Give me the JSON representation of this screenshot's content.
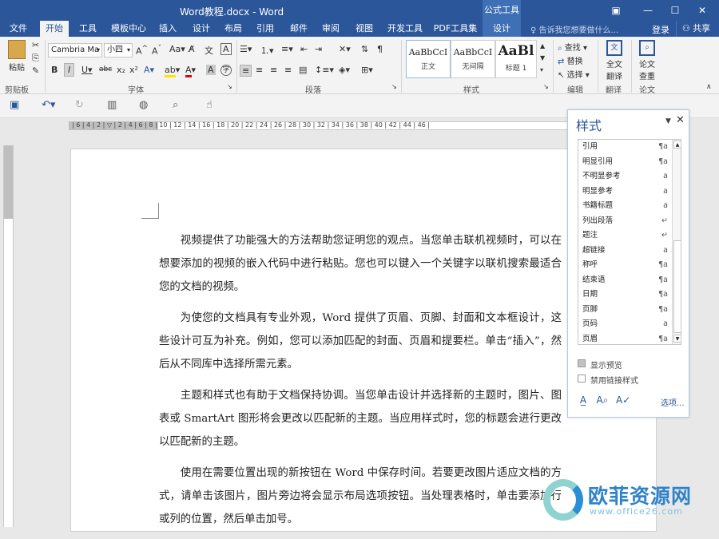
{
  "window": {
    "title": "Word教程.docx - Word",
    "context_tab": "公式工具"
  },
  "tabs": [
    "文件",
    "开始",
    "工具",
    "模板中心",
    "插入",
    "设计",
    "布局",
    "引用",
    "邮件",
    "审阅",
    "视图",
    "开发工具",
    "PDF工具集",
    "设计"
  ],
  "active_tab": "开始",
  "tellme_placeholder": "告诉我您想要做什么...",
  "account": {
    "login": "登录",
    "share": "共享"
  },
  "ribbon": {
    "clipboard": {
      "paste": "粘贴",
      "label": "剪贴板"
    },
    "font": {
      "name": "Cambria Ma",
      "size": "小四",
      "label": "字体"
    },
    "paragraph": {
      "label": "段落"
    },
    "styles": {
      "label": "样式",
      "items": [
        {
          "sample": "AaBbCcI",
          "name": "正文"
        },
        {
          "sample": "AaBbCcI",
          "name": "无间隔"
        },
        {
          "sample": "AaBl",
          "name": "标题 1"
        }
      ]
    },
    "editing": {
      "find": "查找",
      "replace": "替换",
      "select": "选择",
      "label": "编辑"
    },
    "translate": {
      "btn1": "全文",
      "btn2": "翻译",
      "label": "翻译"
    },
    "paper": {
      "btn1": "论文",
      "btn2": "查重",
      "label": "论文"
    }
  },
  "ruler": {
    "numbers": "| 6 | 4 | 2 | ▽ | 2 | 4 | 6 | 8 | 10 | 12 | 14 | 16 | 18 | 20 | 22 | 24 | 26 | 28 | 30 | 32 | 34 | 36 | 38 | 40 | 42 | 44 | 46 |"
  },
  "document": {
    "paragraphs": [
      "视频提供了功能强大的方法帮助您证明您的观点。当您单击联机视频时，可以在想要添加的视频的嵌入代码中进行粘贴。您也可以键入一个关键字以联机搜索最适合您的文档的视频。",
      "为使您的文档具有专业外观，Word 提供了页眉、页脚、封面和文本框设计，这些设计可互为补充。例如，您可以添加匹配的封面、页眉和提要栏。单击“插入”，然后从不同库中选择所需元素。",
      "主题和样式也有助于文档保持协调。当您单击设计并选择新的主题时，图片、图表或 SmartArt 图形将会更改以匹配新的主题。当应用样式时，您的标题会进行更改以匹配新的主题。",
      "使用在需要位置出现的新按钮在 Word 中保存时间。若要更改图片适应文档的方式，请单击该图片，图片旁边将会显示布局选项按钮。当处理表格时，单击要添加行或列的位置，然后单击加号。"
    ]
  },
  "styles_pane": {
    "title": "样式",
    "items": [
      {
        "name": "引用",
        "mark": "¶a"
      },
      {
        "name": "明显引用",
        "mark": "¶a"
      },
      {
        "name": "不明显参考",
        "mark": "a"
      },
      {
        "name": "明显参考",
        "mark": "a"
      },
      {
        "name": "书籍标题",
        "mark": "a"
      },
      {
        "name": "列出段落",
        "mark": "↵"
      },
      {
        "name": "题注",
        "mark": "↵"
      },
      {
        "name": "超链接",
        "mark": "a"
      },
      {
        "name": "称呼",
        "mark": "¶a"
      },
      {
        "name": "结束语",
        "mark": "¶a"
      },
      {
        "name": "日期",
        "mark": "¶a"
      },
      {
        "name": "页脚",
        "mark": "¶a"
      },
      {
        "name": "页码",
        "mark": "a"
      },
      {
        "name": "页眉",
        "mark": "¶a"
      }
    ],
    "show_preview": {
      "label": "显示预览",
      "checked": true
    },
    "disable_linked": {
      "label": "禁用链接样式",
      "checked": false
    },
    "options": "选项..."
  },
  "watermark": {
    "brand": "欧菲资源网",
    "url": "www.office26.com"
  }
}
